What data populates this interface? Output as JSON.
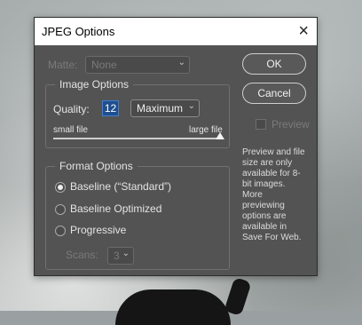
{
  "dialog": {
    "title": "JPEG Options",
    "close_glyph": "×"
  },
  "matte": {
    "label": "Matte:",
    "value": "None"
  },
  "image_options": {
    "title": "Image Options",
    "quality_label": "Quality:",
    "quality_value": "12",
    "quality_preset": "Maximum",
    "slider_min_label": "small file",
    "slider_max_label": "large file",
    "slider_level": 1.0
  },
  "format_options": {
    "title": "Format Options",
    "options": [
      "Baseline (“Standard”)",
      "Baseline Optimized",
      "Progressive"
    ],
    "selected_index": 0,
    "scans_label": "Scans:",
    "scans_value": "3"
  },
  "buttons": {
    "ok": "OK",
    "cancel": "Cancel"
  },
  "preview": {
    "label": "Preview",
    "checked": false,
    "note": "Preview and file size are only available for 8-bit images. More previewing options are available in Save For Web."
  },
  "icons": {
    "close": "close-icon",
    "chevron": "chevron-down-icon"
  }
}
